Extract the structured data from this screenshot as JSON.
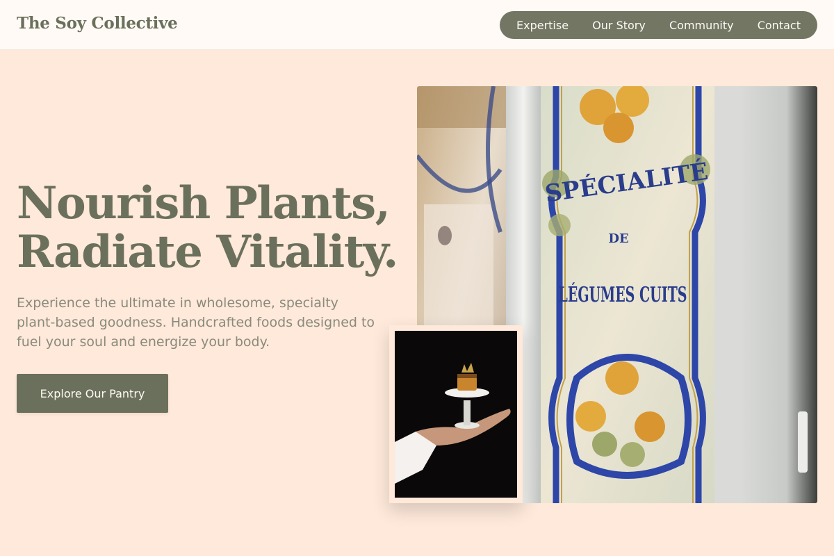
{
  "header": {
    "brand": "The Soy Collective",
    "nav": [
      "Expertise",
      "Our Story",
      "Community",
      "Contact"
    ]
  },
  "hero": {
    "headline_line1": "Nourish Plants,",
    "headline_line2": "Radiate Vitality.",
    "subtext": "Experience the ultimate in wholesome, specialty plant-based goodness. Handcrafted foods designed to fuel your soul and energize your body.",
    "cta_label": "Explore Our Pantry"
  },
  "images": {
    "main_sign": {
      "line1": "SPÉCIALITÉ",
      "line2": "DE",
      "line3": "LÉGUMES CUITS"
    }
  },
  "colors": {
    "page_bg": "#fee9da",
    "header_bg": "#fffaf5",
    "accent": "#6b705c"
  }
}
